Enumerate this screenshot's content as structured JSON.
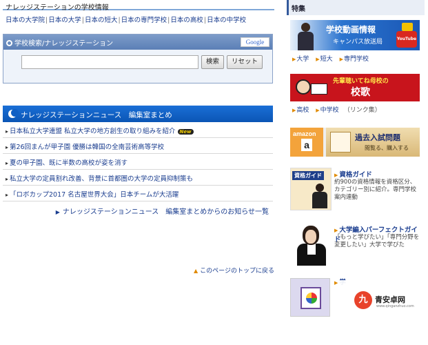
{
  "left": {
    "section_title": "ナレッジステーションの学校情報",
    "school_links": [
      "日本の大学院",
      "日本の大学",
      "日本の短大",
      "日本の専門学校",
      "日本の高校",
      "日本の中学校"
    ],
    "search": {
      "title": "学校検索/ナレッジステーション",
      "badge": "Google",
      "input_value": "",
      "submit_label": "検索",
      "reset_label": "リセット"
    },
    "news": {
      "title": "ナレッジステーションニュース　編集室まとめ",
      "items": [
        "日本私立大学連盟 私立大学の地方創生の取り組みを紹介",
        "第26回まんが甲子園 優勝は韓国の全南芸術高等学校",
        "夏の甲子園、既に半数の高校が姿を消す",
        "私立大学の定員割れ改善、背景に首都圏の大学の定員抑制策も",
        "「ロボカップ2017 名古屋世界大会」日本チームが大活躍"
      ],
      "new_badge": "New",
      "more_link": "ナレッジステーションニュース　編集室まとめからのお知らせ一覧"
    },
    "page_top_link": "このページのトップに戻る"
  },
  "right": {
    "header": "特集",
    "banner1": {
      "title": "学校動画情報",
      "subtitle": "キャンパス放送局",
      "badge": "YouTube"
    },
    "cat_links_1": [
      "大学",
      "短大",
      "専門学校"
    ],
    "banner2": {
      "line1": "先輩聴いてね母校の",
      "line2": "校歌"
    },
    "cat_links_2": [
      "高校",
      "中学校"
    ],
    "cat_links_2_note": "（リンク集）",
    "banner3": {
      "amazon": "amazon",
      "amazon_letter": "a",
      "title": "過去入試問題",
      "subtitle": "閲覧る、購入する"
    },
    "card1": {
      "img_label": "資格ガイド",
      "title": "資格ガイド",
      "desc": "約900の資格情報を資格区分、カテゴリー別に紹介。専門学校案内連動"
    },
    "card2": {
      "title": "大学編入パーフェクトガイド",
      "desc": "「もっと学びたい」「専門分野を変更したい」大学で学びた"
    },
    "card3": {
      "title": "学"
    }
  },
  "watermark": {
    "logo": "九",
    "text": "青安卓网",
    "url": "www.qinganzhuo.com"
  }
}
